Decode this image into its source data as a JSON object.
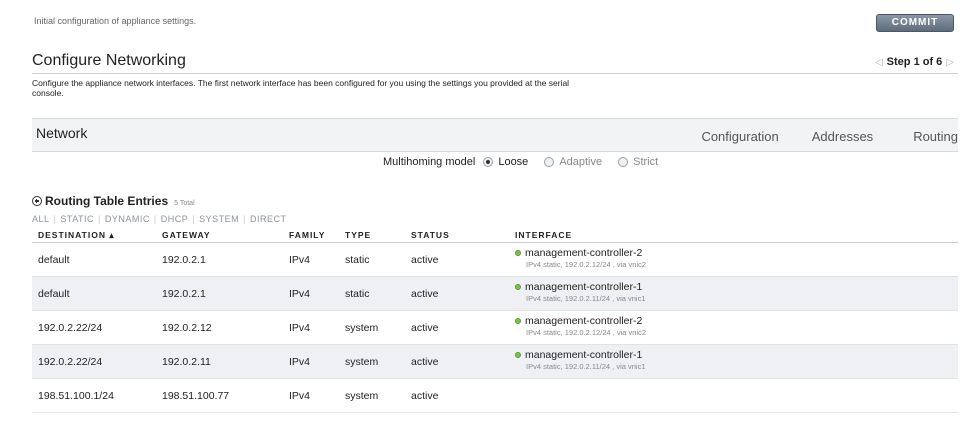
{
  "header": {
    "intro_text": "Initial configuration of appliance settings.",
    "commit_label": "COMMIT"
  },
  "page": {
    "title": "Configure Networking",
    "step_label": "Step 1 of 6",
    "description": "Configure the appliance network interfaces. The first network interface has been configured for you using the settings you provided at the serial console."
  },
  "section": {
    "title": "Network",
    "tabs": [
      "Configuration",
      "Addresses",
      "Routing"
    ]
  },
  "multihoming": {
    "label": "Multihoming model",
    "options": [
      {
        "label": "Loose",
        "selected": true
      },
      {
        "label": "Adaptive",
        "selected": false
      },
      {
        "label": "Strict",
        "selected": false
      }
    ]
  },
  "routing": {
    "title": "Routing Table Entries",
    "total": "5 Total",
    "filters": [
      "ALL",
      "STATIC",
      "DYNAMIC",
      "DHCP",
      "SYSTEM",
      "DIRECT"
    ],
    "columns": [
      "DESTINATION ▴",
      "GATEWAY",
      "FAMILY",
      "TYPE",
      "STATUS",
      "INTERFACE"
    ],
    "rows": [
      {
        "destination": "default",
        "gateway": "192.0.2.1",
        "family": "IPv4",
        "type": "static",
        "status": "active",
        "interface": "management-controller-2",
        "interface_detail": "IPv4 static, 192.0.2.12/24 , via vnic2"
      },
      {
        "destination": "default",
        "gateway": "192.0.2.1",
        "family": "IPv4",
        "type": "static",
        "status": "active",
        "interface": "management-controller-1",
        "interface_detail": "IPv4 static, 192.0.2.11/24 , via vnic1"
      },
      {
        "destination": "192.0.2.22/24",
        "gateway": "192.0.2.12",
        "family": "IPv4",
        "type": "system",
        "status": "active",
        "interface": "management-controller-2",
        "interface_detail": "IPv4 static, 192.0.2.12/24 , via vnic2"
      },
      {
        "destination": "192.0.2.22/24",
        "gateway": "192.0.2.11",
        "family": "IPv4",
        "type": "system",
        "status": "active",
        "interface": "management-controller-1",
        "interface_detail": "IPv4 static, 192.0.2.11/24 , via vnic1"
      },
      {
        "destination": "198.51.100.1/24",
        "gateway": "198.51.100.77",
        "family": "IPv4",
        "type": "system",
        "status": "active",
        "interface": "",
        "interface_detail": ""
      }
    ]
  },
  "colors": {
    "commit_button": "#6b7888",
    "section_bar": "#f1f3f5",
    "status_active_dot": "#7ec24a",
    "row_alt": "#eef0f3"
  }
}
